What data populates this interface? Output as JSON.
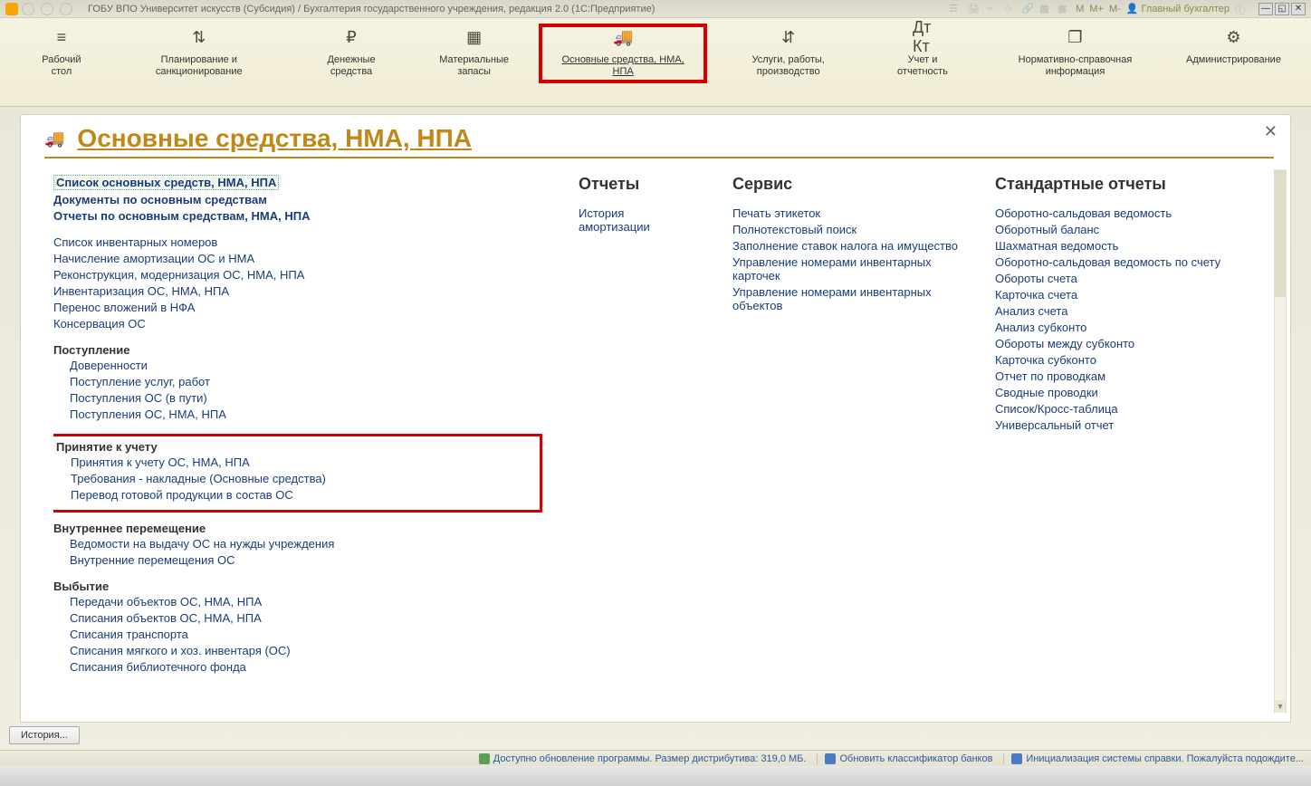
{
  "title_bar": {
    "app_title": "ГОБУ ВПО Университет искусств (Субсидия) / Бухгалтерия государственного учреждения, редакция 2.0  (1С:Предприятие)",
    "m_buttons": [
      "M",
      "M+",
      "M-"
    ],
    "user_label": "Главный бухгалтер"
  },
  "nav": [
    {
      "label": "Рабочий\nстол",
      "icon": "≡"
    },
    {
      "label": "Планирование и\nсанкционирование",
      "icon": "⇅"
    },
    {
      "label": "Денежные\nсредства",
      "icon": "₽"
    },
    {
      "label": "Материальные\nзапасы",
      "icon": "▦"
    },
    {
      "label": "Основные средства,\nНМА, НПА",
      "icon": "🚚",
      "active": true
    },
    {
      "label": "Услуги, работы,\nпроизводство",
      "icon": "⇵"
    },
    {
      "label": "Учет и\nотчетность",
      "icon": "Дт\nКт"
    },
    {
      "label": "Нормативно-справочная\nинформация",
      "icon": "❐"
    },
    {
      "label": "Администрирование",
      "icon": "⚙"
    }
  ],
  "page": {
    "title": "Основные средства, НМА, НПА"
  },
  "col1": {
    "top_bold": [
      "Список основных средств, НМА, НПА",
      "Документы по основным средствам",
      "Отчеты по основным средствам, НМА, НПА"
    ],
    "general_links": [
      "Список инвентарных номеров",
      "Начисление амортизации ОС и НМА",
      "Реконструкция, модернизация ОС, НМА, НПА",
      "Инвентаризация ОС, НМА, НПА",
      "Перенос вложений в НФА",
      "Консервация ОС"
    ],
    "groups": [
      {
        "title": "Поступление",
        "links": [
          "Доверенности",
          "Поступление услуг, работ",
          "Поступления ОС (в пути)",
          "Поступления ОС, НМА, НПА"
        ]
      },
      {
        "title": "Принятие к учету",
        "highlight": true,
        "links": [
          "Принятия к учету ОС, НМА, НПА",
          "Требования - накладные (Основные средства)",
          "Перевод готовой продукции в состав ОС"
        ]
      },
      {
        "title": "Внутреннее перемещение",
        "links": [
          "Ведомости на выдачу ОС на нужды учреждения",
          "Внутренние перемещения ОС"
        ]
      },
      {
        "title": "Выбытие",
        "links": [
          "Передачи объектов ОС, НМА, НПА",
          "Списания объектов ОС, НМА, НПА",
          "Списания транспорта",
          "Списания мягкого и хоз. инвентаря (ОС)",
          "Списания библиотечного фонда"
        ]
      }
    ]
  },
  "col2": {
    "heading": "Отчеты",
    "links": [
      "История амортизации"
    ]
  },
  "col3": {
    "heading": "Сервис",
    "links": [
      "Печать этикеток",
      "Полнотекстовый поиск",
      "Заполнение ставок налога на имущество",
      "Управление номерами инвентарных карточек",
      "Управление номерами инвентарных объектов"
    ]
  },
  "col4": {
    "heading": "Стандартные отчеты",
    "links": [
      "Оборотно-сальдовая ведомость",
      "Оборотный баланс",
      "Шахматная ведомость",
      "Оборотно-сальдовая ведомость по счету",
      "Обороты счета",
      "Карточка счета",
      "Анализ счета",
      "Анализ субконто",
      "Обороты между субконто",
      "Карточка субконто",
      "Отчет по проводкам",
      "Сводные проводки",
      "Список/Кросс-таблица",
      "Универсальный отчет"
    ]
  },
  "tab_history": "История...",
  "status": {
    "update": "Доступно обновление программы. Размер дистрибутива: 319,0 МБ.",
    "banks": "Обновить классификатор банков",
    "help": "Инициализация системы справки. Пожалуйста подождите..."
  }
}
